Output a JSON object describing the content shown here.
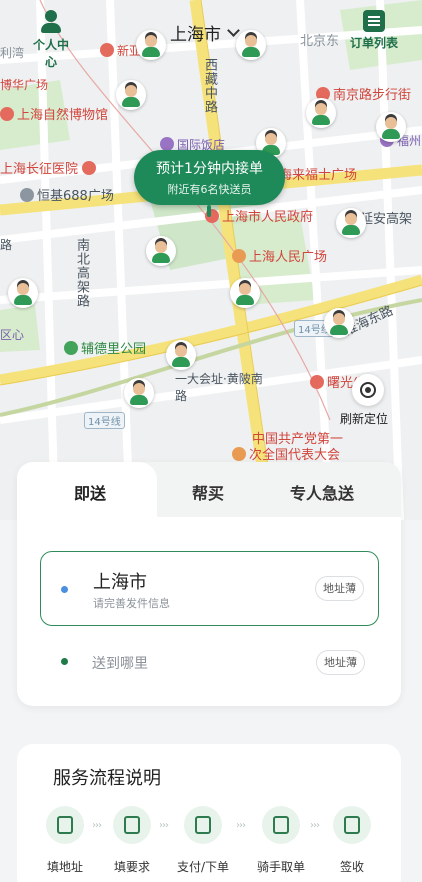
{
  "header": {
    "profile_label": "个人中心",
    "city": "上海市",
    "orders_label": "订单列表"
  },
  "map": {
    "labels": {
      "xin_ya": "新亚",
      "hua_guang": "博华广场",
      "nature_museum": "上海自然博物馆",
      "xizang_road": "西藏中路",
      "nanjing_pedestrian": "南京路步行街",
      "fuzhou": "福州",
      "intl_hotel": "国际饭店",
      "changzheng_hospital": "上海长征医院",
      "hengji": "恒基688广场",
      "raffles": "上海来福士广场",
      "people_gov": "上海市人民政府",
      "yanan_elevated": "延安高架",
      "peoples_square": "上海人民广场",
      "north_south_elevated": "南北高架路",
      "huaihai_east": "淮海东路",
      "fudeli_park": "辅德里公园",
      "dayi_huiyi": "一大会址·黄陂南路",
      "district": "区心",
      "road_left": "路",
      "shuguang": "曙光(西",
      "cpc_first": "中国共产党第一次全国代表大会",
      "cpc_line1": "中国共产党第一",
      "cpc_line2": "次全国代表大会",
      "north_jingdong": "北京东",
      "li_wen": "利湾",
      "metro14": "14号线"
    },
    "bubble": {
      "eta": "预计1分钟内接单",
      "nearby": "附近有6名快送员"
    },
    "relocate_label": "刷新定位"
  },
  "tabs": [
    {
      "label": "即送",
      "active": true
    },
    {
      "label": "帮买",
      "active": false
    },
    {
      "label": "专人急送",
      "active": false
    }
  ],
  "sender": {
    "city": "上海市",
    "hint": "请完善发件信息",
    "address_book": "地址薄"
  },
  "receiver": {
    "placeholder": "送到哪里",
    "address_book": "地址薄"
  },
  "process": {
    "title": "服务流程说明",
    "steps": [
      "填地址",
      "填要求",
      "支付/下单",
      "骑手取单",
      "签收"
    ]
  },
  "colors": {
    "brand_green": "#1e8a5a",
    "poi_red": "#d2453c",
    "sender_dot": "#4a8fe0"
  }
}
